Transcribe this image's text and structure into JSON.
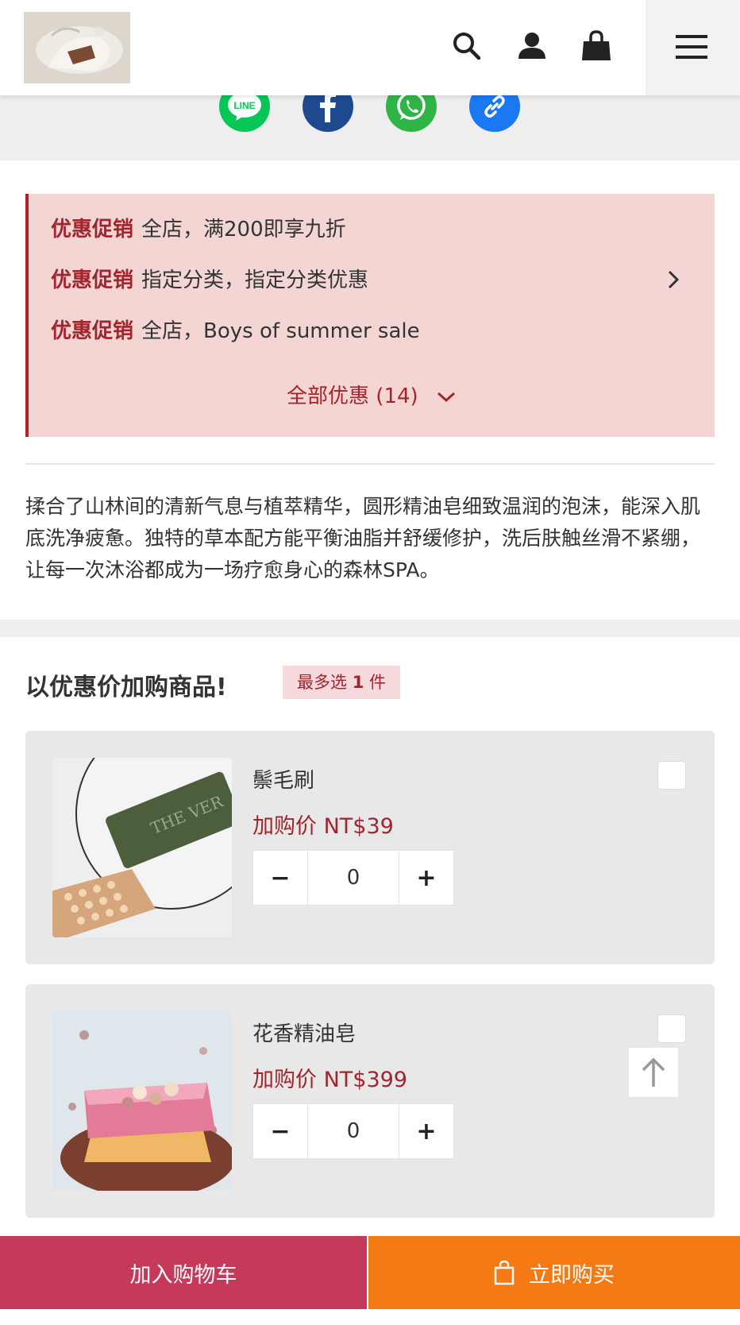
{
  "header": {
    "logo_alt": "shop logo",
    "icons": [
      "search-icon",
      "user-icon",
      "shopping-bag-icon",
      "menu-icon"
    ]
  },
  "share": {
    "buttons": [
      {
        "name": "line",
        "label": "LINE",
        "color": "#06c755"
      },
      {
        "name": "facebook",
        "label": "f",
        "color": "#1d4a8f"
      },
      {
        "name": "whatsapp",
        "label": "whatsapp",
        "color": "#2fb545"
      },
      {
        "name": "copy-link",
        "label": "link",
        "color": "#1a78f2"
      }
    ]
  },
  "promotions": {
    "items": [
      {
        "tag": "优惠促销",
        "text": "全店，满200即享九折"
      },
      {
        "tag": "优惠促销",
        "text": "指定分类，指定分类优惠"
      },
      {
        "tag": "优惠促销",
        "text": "全店，Boys of summer sale"
      }
    ],
    "view_all": "全部优惠 (14)",
    "accent_color": "#a2242c",
    "background": "#f3d6d4"
  },
  "description": "揉合了山林间的清新气息与植萃精华，圆形精油皂细致温润的泡沫，能深入肌底洗净疲惫。独特的草本配方能平衡油脂并舒缓修护，洗后肤触丝滑不紧绷，让每一次沐浴都成为一场疗愈身心的森林SPA。",
  "addon": {
    "title": "以优惠价加购商品!",
    "limit_prefix": "最多选 ",
    "limit_count": "1",
    "limit_suffix": " 件",
    "items": [
      {
        "name": "鬃毛刷",
        "price": "加购价  NT$39",
        "quantity": "0",
        "minus": "−",
        "plus": "+"
      },
      {
        "name": "花香精油皂",
        "price": "加购价  NT$399",
        "quantity": "0",
        "minus": "−",
        "plus": "+"
      }
    ]
  },
  "actions": {
    "add_to_cart": "加入购物车",
    "buy_now": "立即购买",
    "cart_color": "#c5395a",
    "buy_color": "#f57a14"
  }
}
